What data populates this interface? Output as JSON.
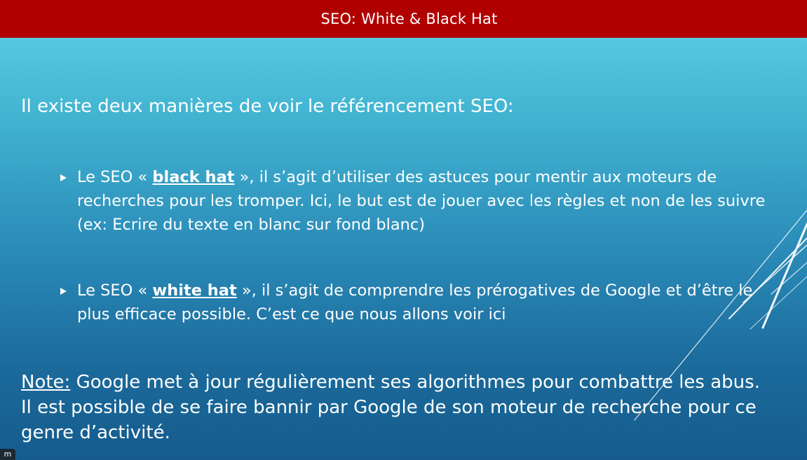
{
  "slide": {
    "title": "SEO: White & Black Hat",
    "intro": "Il existe deux manières de voir le référencement SEO:",
    "bullets": [
      {
        "prefix": "Le SEO « ",
        "keyword": "black hat",
        "text": " », il s’agit d’utiliser des astuces pour mentir aux moteurs de recherches pour les tromper. Ici, le but est de jouer avec les règles et non de les suivre (ex: Ecrire du texte en blanc sur fond blanc)"
      },
      {
        "prefix": "Le SEO « ",
        "keyword": "white hat",
        "text": " », il s’agit de comprendre les prérogatives de Google et d’être le plus efficace possible. C’est ce que nous allons voir ici"
      }
    ],
    "note": {
      "label": "Note:",
      "text": " Google met à jour régulièrement ses algorithmes pour combattre les abus. Il est possible de se faire bannir par Google de son moteur de recherche pour ce genre d’activité."
    }
  },
  "corner_badge": "m",
  "colors": {
    "title_bar": "#b00000",
    "background_top": "#5dd4e6",
    "background_bottom": "#155c8d",
    "text": "#ffffff"
  }
}
